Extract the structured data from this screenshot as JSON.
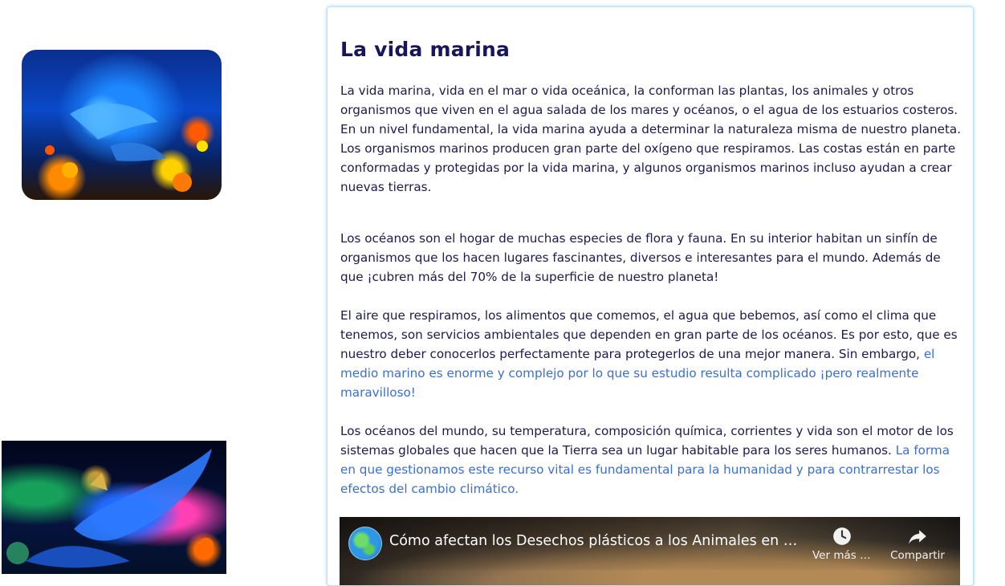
{
  "article": {
    "title": "La vida marina",
    "p1": "La vida marina, vida en el mar o vida oceánica, la conforman las plantas, los animales y otros organismos que viven en el agua salada de los mares y océanos, o el agua de los estuarios costeros. En un nivel fundamental, la vida marina ayuda a determinar la naturaleza misma de nuestro planeta. Los organismos marinos producen gran parte del oxígeno que respiramos. Las costas están en parte conformadas y protegidas por la vida marina, y algunos organismos marinos incluso ayudan a crear nuevas tierras.",
    "p2": "Los océanos son el hogar de muchas especies de flora y fauna. En su interior habitan un sinfín de organismos que los hacen lugares fascinantes, diversos e interesantes para el mundo. Además de que ¡cubren más del 70% de la superficie de nuestro planeta!",
    "p3_text": "El aire que respiramos, los alimentos que comemos, el agua que bebemos, así como el clima que tenemos, son servicios ambientales que dependen en gran parte de los océanos. Es por esto, que es nuestro deber conocerlos perfectamente para protegerlos de una mejor manera. Sin embargo, ",
    "p3_link": "el medio marino es enorme y complejo por lo que su estudio resulta complicado ¡pero realmente maravilloso!",
    "p4_text": "Los océanos del mundo, su temperatura, composición química, corrientes y vida son el motor de los sistemas globales que hacen que la Tierra sea un lugar habitable para los seres humanos. ",
    "p4_link": "La forma en que gestionamos este recurso vital es fundamental para la humanidad y para contrarrestar los efectos del cambio climático."
  },
  "video": {
    "title": "Cómo afectan los Desechos plásticos a los Animales en el océano",
    "watch_later_label": "Ver más tarde",
    "share_label": "Compartir",
    "watch_later_icon": "clock-icon",
    "share_icon": "share-arrow-icon"
  },
  "colors": {
    "title": "#18165a",
    "text": "#1c1a4e",
    "link": "#3a6fd0",
    "card_border": "#bfe0f3"
  }
}
